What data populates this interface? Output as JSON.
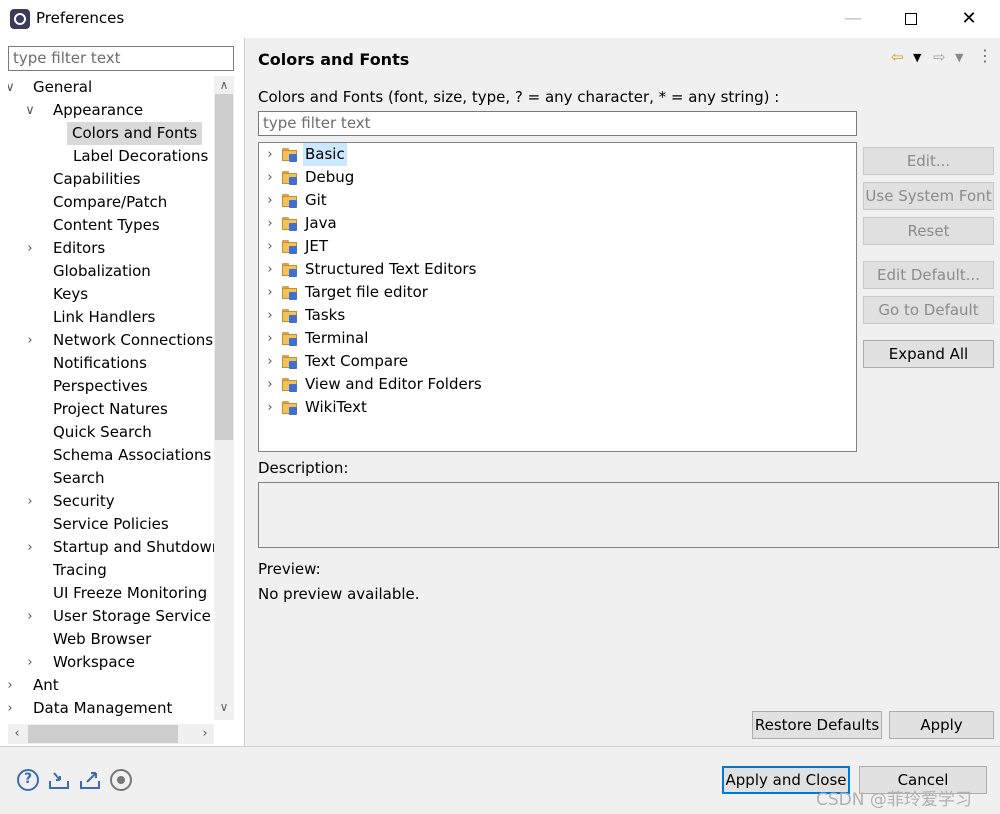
{
  "window": {
    "title": "Preferences"
  },
  "left_panel": {
    "filter_placeholder": "type filter text",
    "tree": [
      {
        "label": "General",
        "level": 0,
        "expanded": true
      },
      {
        "label": "Appearance",
        "level": 1,
        "expanded": true
      },
      {
        "label": "Colors and Fonts",
        "level": 2,
        "selected": true
      },
      {
        "label": "Label Decorations",
        "level": 2
      },
      {
        "label": "Capabilities",
        "level": 1
      },
      {
        "label": "Compare/Patch",
        "level": 1
      },
      {
        "label": "Content Types",
        "level": 1
      },
      {
        "label": "Editors",
        "level": 1,
        "expandable": true
      },
      {
        "label": "Globalization",
        "level": 1
      },
      {
        "label": "Keys",
        "level": 1
      },
      {
        "label": "Link Handlers",
        "level": 1
      },
      {
        "label": "Network Connections",
        "level": 1,
        "expandable": true
      },
      {
        "label": "Notifications",
        "level": 1
      },
      {
        "label": "Perspectives",
        "level": 1
      },
      {
        "label": "Project Natures",
        "level": 1
      },
      {
        "label": "Quick Search",
        "level": 1
      },
      {
        "label": "Schema Associations",
        "level": 1
      },
      {
        "label": "Search",
        "level": 1
      },
      {
        "label": "Security",
        "level": 1,
        "expandable": true
      },
      {
        "label": "Service Policies",
        "level": 1
      },
      {
        "label": "Startup and Shutdown",
        "level": 1,
        "expandable": true
      },
      {
        "label": "Tracing",
        "level": 1
      },
      {
        "label": "UI Freeze Monitoring",
        "level": 1
      },
      {
        "label": "User Storage Service",
        "level": 1,
        "expandable": true
      },
      {
        "label": "Web Browser",
        "level": 1
      },
      {
        "label": "Workspace",
        "level": 1,
        "expandable": true
      },
      {
        "label": "Ant",
        "level": 0,
        "expandable": true
      },
      {
        "label": "Data Management",
        "level": 0,
        "expandable": true
      }
    ]
  },
  "right_panel": {
    "title": "Colors and Fonts",
    "hint": "Colors and Fonts (font, size, type, ? = any character, * = any string) :",
    "filter_placeholder": "type filter text",
    "categories": [
      "Basic",
      "Debug",
      "Git",
      "Java",
      "JET",
      "Structured Text Editors",
      "Target file editor",
      "Tasks",
      "Terminal",
      "Text Compare",
      "View and Editor Folders",
      "WikiText"
    ],
    "buttons": {
      "edit": "Edit...",
      "use_system_font": "Use System Font",
      "reset": "Reset",
      "edit_default": "Edit Default...",
      "go_to_default": "Go to Default",
      "expand_all": "Expand All"
    },
    "description_label": "Description:",
    "preview_label": "Preview:",
    "preview_text": "No preview available.",
    "restore_defaults": "Restore Defaults",
    "apply": "Apply"
  },
  "footer": {
    "apply_and_close": "Apply and Close",
    "cancel": "Cancel",
    "watermark": "CSDN @菲玲爱学习"
  },
  "colors": {
    "selection": "#cce8ff",
    "default_button_border": "#0078d7",
    "folder": "#f0c15c"
  },
  "icons": [
    "help-icon",
    "import-icon",
    "export-icon",
    "record-icon",
    "back-arrow-icon",
    "forward-arrow-icon",
    "view-menu-icon"
  ]
}
